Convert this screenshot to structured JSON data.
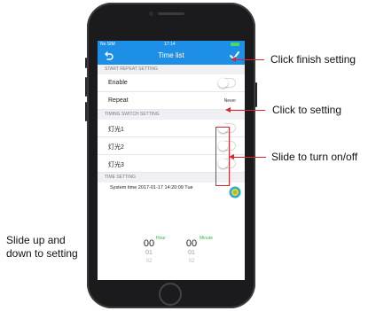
{
  "status_bar": {
    "carrier": "No SIM",
    "time": "17:14"
  },
  "nav": {
    "title": "Time list",
    "back_icon": "back-arrow-icon",
    "confirm_icon": "checkmark-icon"
  },
  "sections": {
    "repeat": "START REPEAT SETTING",
    "timing": "TIMING SWITCH SETTING",
    "time": "TIME SETTING"
  },
  "repeat_rows": {
    "enable_label": "Enable",
    "enable_on": false,
    "repeat_label": "Repeat",
    "repeat_value": "Never"
  },
  "switches": [
    {
      "label": "灯光1",
      "on": false
    },
    {
      "label": "灯光2",
      "on": false
    },
    {
      "label": "灯光3",
      "on": false
    }
  ],
  "system_time": "System time 2017-01-17 14:20:09 Tue",
  "picker": {
    "hour_value": "00",
    "hour_unit": "Hour",
    "hour_next": "01",
    "hour_next2": "02",
    "minute_value": "00",
    "minute_unit": "Minute",
    "minute_next": "01",
    "minute_next2": "02"
  },
  "annotations": {
    "finish": "Click finish setting",
    "setting": "Click to setting",
    "slide": "Slide to turn on/off",
    "updown_1": "Slide up and",
    "updown_2": "down to setting"
  },
  "colors": {
    "nav_blue": "#1e8fe6",
    "annotation_red": "#e0242b",
    "unit_green": "#39b54a"
  }
}
